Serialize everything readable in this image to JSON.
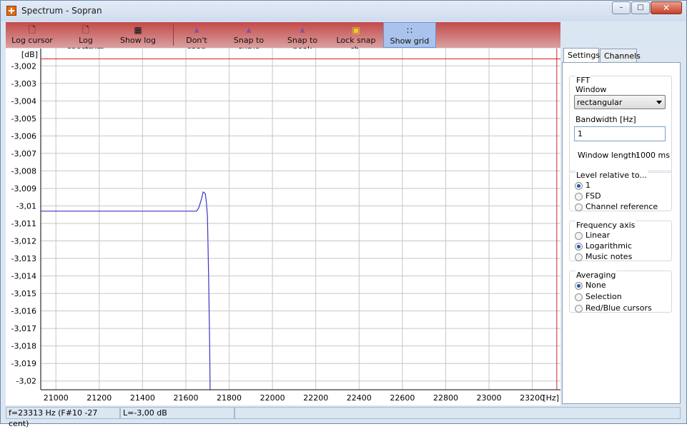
{
  "window": {
    "title": "Spectrum - Sopran",
    "min_label": "–",
    "max_label": "□",
    "close_label": "✕"
  },
  "toolbar": {
    "buttons": [
      {
        "label": "Log cursor",
        "icon": "log-icon"
      },
      {
        "label": "Log spectrum",
        "icon": "log-icon"
      },
      {
        "label": "Show log",
        "icon": "table-icon"
      },
      {
        "label": "Don't snap",
        "icon": "curve-icon"
      },
      {
        "label": "Snap to curve",
        "icon": "curve-icon"
      },
      {
        "label": "Snap to peak",
        "icon": "curve-icon"
      },
      {
        "label": "Lock snap ch.",
        "icon": "lock-icon"
      },
      {
        "label": "Show grid",
        "icon": "grid-icon",
        "active": true
      }
    ]
  },
  "chart_data": {
    "type": "line",
    "ylabel": "[dB]",
    "xlabel": "[Hz]",
    "xlim": [
      20930,
      23330
    ],
    "ylim": [
      -3.0205,
      -3.0015
    ],
    "x_ticks": [
      21000,
      21200,
      21400,
      21600,
      21800,
      22000,
      22200,
      22400,
      22600,
      22800,
      23000,
      23200
    ],
    "x_tick_labels": [
      "21000",
      "21200",
      "21400",
      "21600",
      "21800",
      "22000",
      "22200",
      "22400",
      "22600",
      "22800",
      "23000",
      "23200"
    ],
    "y_ticks": [
      -3.002,
      -3.003,
      -3.004,
      -3.005,
      -3.006,
      -3.007,
      -3.008,
      -3.009,
      -3.01,
      -3.011,
      -3.012,
      -3.013,
      -3.014,
      -3.015,
      -3.016,
      -3.017,
      -3.018,
      -3.019,
      -3.02
    ],
    "y_tick_labels": [
      "-3,002",
      "-3,003",
      "-3,004",
      "-3,005",
      "-3,006",
      "-3,007",
      "-3,008",
      "-3,009",
      "-3,01",
      "-3,011",
      "-3,012",
      "-3,013",
      "-3,014",
      "-3,015",
      "-3,016",
      "-3,017",
      "-3,018",
      "-3,019",
      "-3,02"
    ],
    "grid": true,
    "series": [
      {
        "color": "#3a33c8",
        "x": [
          20930,
          21100,
          21300,
          21500,
          21650,
          21660,
          21670,
          21680,
          21690,
          21695,
          21700,
          21705,
          21710,
          21712
        ],
        "y": [
          -3.0103,
          -3.0103,
          -3.0103,
          -3.0103,
          -3.0103,
          -3.0101,
          -3.0097,
          -3.0092,
          -3.0093,
          -3.0098,
          -3.0106,
          -3.014,
          -3.018,
          -3.0205
        ]
      }
    ],
    "cursor_red_x": 23313,
    "cursor_red_y": -3.0016,
    "cursor_color": "#d32020"
  },
  "settings_panel": {
    "tabs": [
      "Settings",
      "Channels"
    ],
    "fft": {
      "title": "FFT",
      "window_label": "Window",
      "window_value": "rectangular",
      "bandwidth_label": "Bandwidth [Hz]",
      "bandwidth_value": "1",
      "window_length_label": "Window length:",
      "window_length_value": "1000 ms"
    },
    "level": {
      "title": "Level relative to...",
      "options": [
        "1",
        "FSD",
        "Channel reference"
      ],
      "selected": 0
    },
    "frequency": {
      "title": "Frequency axis",
      "options": [
        "Linear",
        "Logarithmic",
        "Music notes"
      ],
      "selected": 1
    },
    "averaging": {
      "title": "Averaging",
      "options": [
        "None",
        "Selection",
        "Red/Blue cursors"
      ],
      "selected": 0
    }
  },
  "status": {
    "frequency": "f=23313 Hz (F#10 -27 cent)",
    "level": "L=-3,00 dB"
  }
}
